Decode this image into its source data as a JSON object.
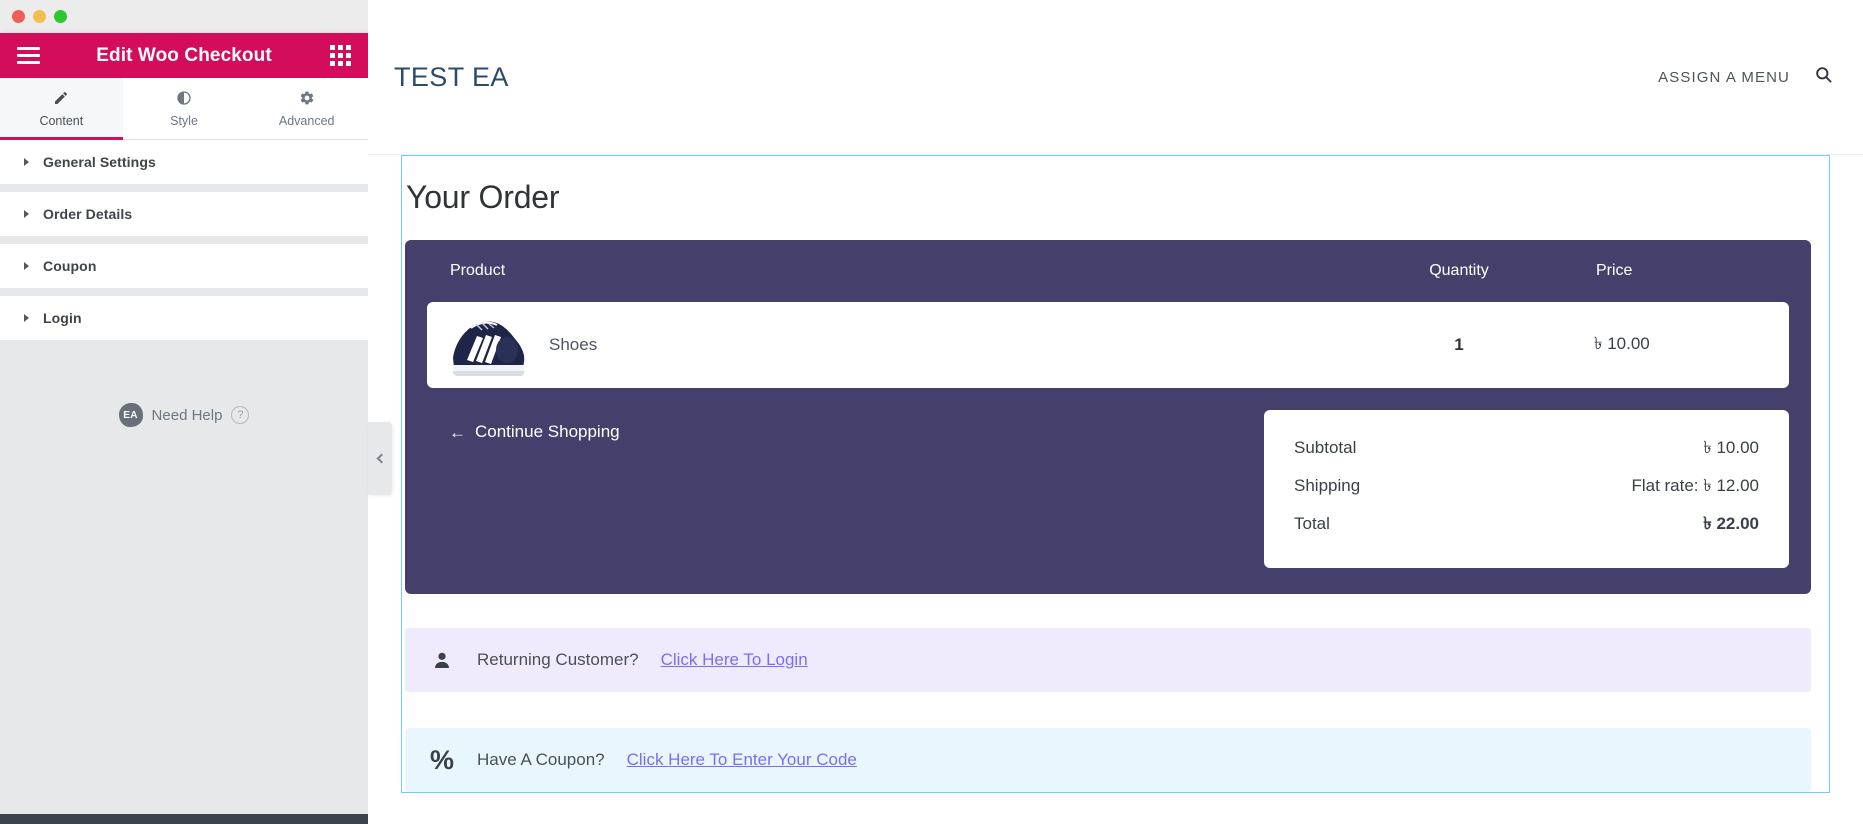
{
  "window": {
    "traffic_lights": [
      "close",
      "minimize",
      "maximize"
    ]
  },
  "panel": {
    "title": "Edit Woo Checkout",
    "menu_icon": "hamburger-icon",
    "apps_icon": "grid-apps-icon",
    "tabs": [
      {
        "label": "Content",
        "icon": "pencil-icon",
        "active": true
      },
      {
        "label": "Style",
        "icon": "contrast-icon",
        "active": false
      },
      {
        "label": "Advanced",
        "icon": "gear-icon",
        "active": false
      }
    ],
    "sections": [
      {
        "label": "General Settings"
      },
      {
        "label": "Order Details"
      },
      {
        "label": "Coupon"
      },
      {
        "label": "Login"
      }
    ],
    "help": {
      "badge": "EA",
      "label": "Need Help",
      "question_mark": "?"
    },
    "collapse_icon": "chevron-left-icon",
    "accent_color": "#d30c5c",
    "background_color": "#e6e8ea"
  },
  "preview": {
    "site_title": "TEST EA",
    "assign_menu": "ASSIGN A MENU",
    "search_icon": "search-icon",
    "selection_color": "#6ecff5"
  },
  "order": {
    "heading": "Your Order",
    "panel_color": "#443f6b",
    "columns": {
      "product": "Product",
      "quantity": "Quantity",
      "price": "Price"
    },
    "items": [
      {
        "thumb": "navy-sneaker-image",
        "name": "Shoes",
        "quantity": "1",
        "price": "৳ 10.00"
      }
    ],
    "continue_shopping": {
      "arrow": "←",
      "label": "Continue Shopping"
    },
    "totals": [
      {
        "label": "Subtotal",
        "value": "৳ 10.00",
        "grand": false
      },
      {
        "label": "Shipping",
        "value": "Flat rate: ৳ 12.00",
        "grand": false
      },
      {
        "label": "Total",
        "value": "৳ 22.00",
        "grand": true
      }
    ]
  },
  "notices": {
    "login": {
      "icon": "user-icon",
      "text": "Returning Customer?",
      "link": "Click Here To Login",
      "background": "#efebfc"
    },
    "coupon": {
      "icon": "percent-icon",
      "text": "Have A Coupon?",
      "link": "Click Here To Enter Your Code",
      "background": "#e7f7fd"
    },
    "link_color": "#7b6ef0"
  }
}
